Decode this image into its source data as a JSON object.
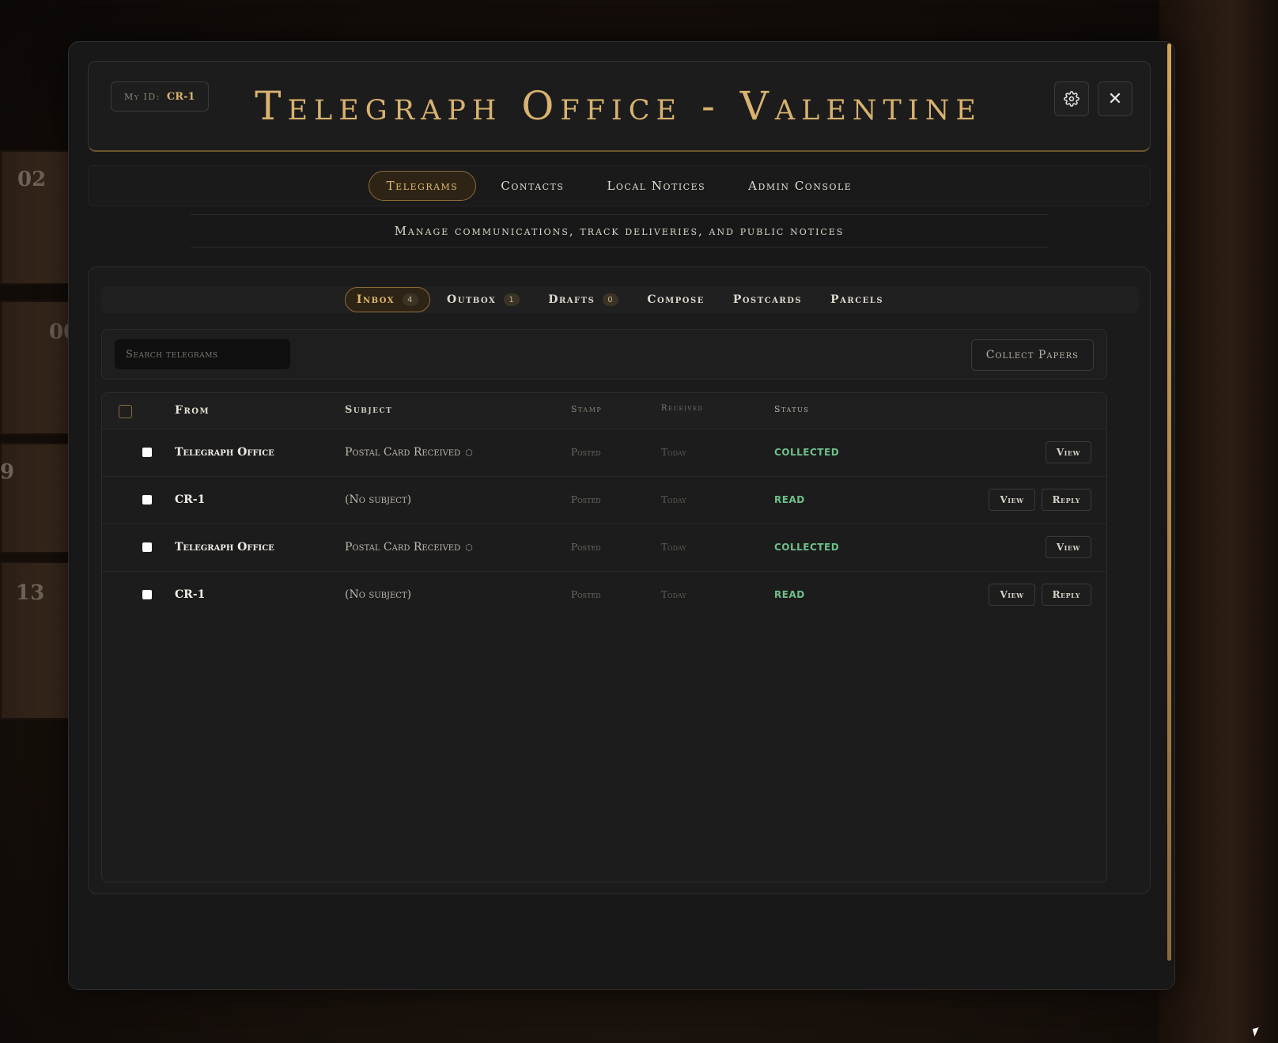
{
  "header": {
    "my_id_label": "My ID:",
    "my_id_value": "CR-1",
    "title": "Telegraph Office - Valentine",
    "close_label": "✕"
  },
  "nav": {
    "tabs": [
      {
        "label": "Telegrams",
        "active": true
      },
      {
        "label": "Contacts",
        "active": false
      },
      {
        "label": "Local Notices",
        "active": false
      },
      {
        "label": "Admin Console",
        "active": false
      }
    ]
  },
  "tagline": "Manage communications, track deliveries, and public notices",
  "subnav": {
    "tabs": [
      {
        "label": "Inbox",
        "badge": "4",
        "active": true
      },
      {
        "label": "Outbox",
        "badge": "1",
        "active": false
      },
      {
        "label": "Drafts",
        "badge": "0",
        "active": false
      },
      {
        "label": "Compose",
        "badge": null,
        "active": false
      },
      {
        "label": "Postcards",
        "badge": null,
        "active": false
      },
      {
        "label": "Parcels",
        "badge": null,
        "active": false
      }
    ]
  },
  "toolbar": {
    "search_placeholder": "Search telegrams",
    "collect_label": "Collect Papers"
  },
  "table": {
    "headers": {
      "from": "From",
      "subject": "Subject",
      "stamp": "Stamp",
      "received": "Received",
      "status": "Status"
    },
    "rows": [
      {
        "from": "Telegraph Office",
        "subject": "Postal Card Received",
        "has_parcel_icon": true,
        "stamp": "Posted",
        "received": "Today",
        "status": "COLLECTED",
        "view": "View",
        "reply": null
      },
      {
        "from": "CR-1",
        "subject": "(No subject)",
        "has_parcel_icon": false,
        "stamp": "Posted",
        "received": "Today",
        "status": "READ",
        "view": "View",
        "reply": "Reply"
      },
      {
        "from": "Telegraph Office",
        "subject": "Postal Card Received",
        "has_parcel_icon": true,
        "stamp": "Posted",
        "received": "Today",
        "status": "COLLECTED",
        "view": "View",
        "reply": null
      },
      {
        "from": "CR-1",
        "subject": "(No subject)",
        "has_parcel_icon": false,
        "stamp": "Posted",
        "received": "Today",
        "status": "READ",
        "view": "View",
        "reply": "Reply"
      }
    ]
  },
  "background": {
    "mailbox_numbers": [
      "02",
      "00",
      "9",
      "13"
    ]
  },
  "colors": {
    "accent_gold": "#d8b26e",
    "status_green": "#6ec08a",
    "panel_dark": "#181818"
  }
}
